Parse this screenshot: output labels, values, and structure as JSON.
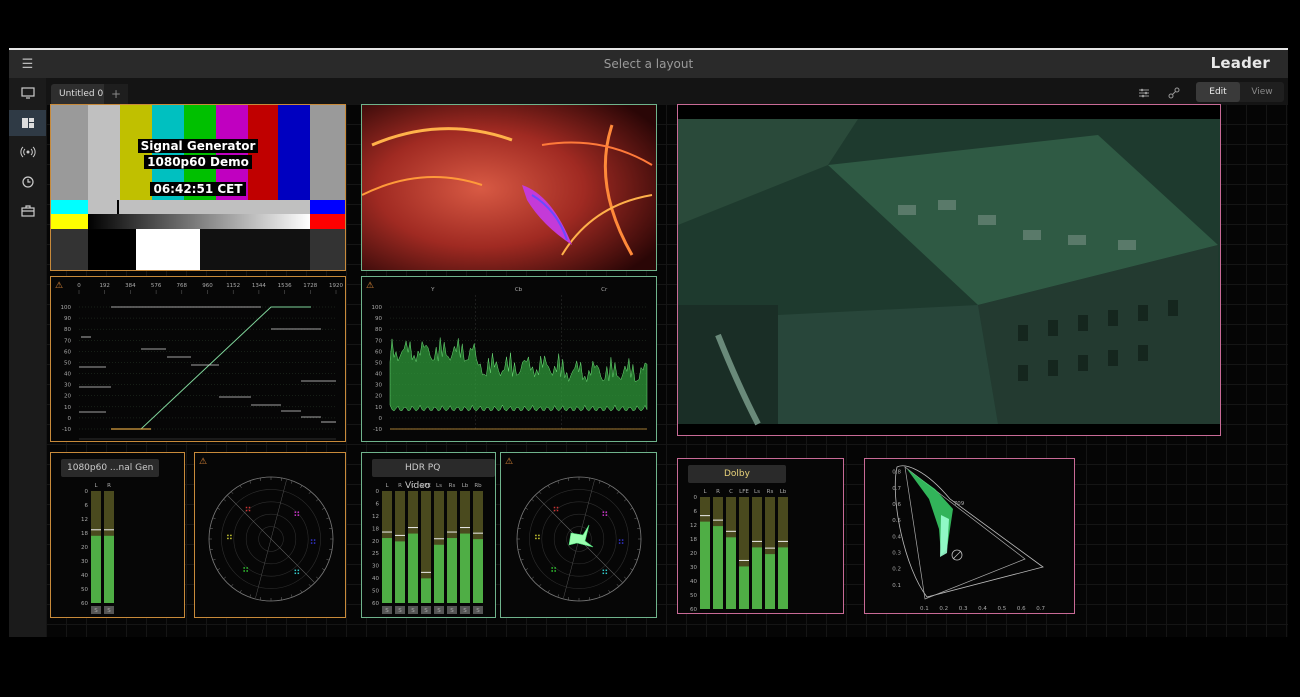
{
  "app": {
    "layout_title": "Select a layout",
    "brand": "Leader",
    "menu_icon": "hamburger-icon"
  },
  "sidebar": {
    "items": [
      {
        "name": "monitor",
        "icon": "monitor-icon"
      },
      {
        "name": "layouts",
        "icon": "layout-icon",
        "active": true
      },
      {
        "name": "signal",
        "icon": "broadcast-icon"
      },
      {
        "name": "clock",
        "icon": "clock-icon"
      },
      {
        "name": "toolbox",
        "icon": "toolbox-icon"
      }
    ]
  },
  "tabs": {
    "items": [
      {
        "label": "Untitled 0"
      }
    ],
    "add_label": "+"
  },
  "toolbar": {
    "settings_icon": "sliders-icon",
    "link_icon": "link-icon",
    "edit_label": "Edit",
    "view_label": "View"
  },
  "signal_generator": {
    "line1": "Signal Generator",
    "line2": "1080p60 Demo",
    "time": "06:42:51 CET"
  },
  "waveform1": {
    "x_ticks": [
      "0",
      "192",
      "384",
      "576",
      "768",
      "960",
      "1152",
      "1344",
      "1536",
      "1728",
      "1920"
    ],
    "y_ticks": [
      "100",
      "90",
      "80",
      "70",
      "60",
      "50",
      "40",
      "30",
      "20",
      "10",
      "0",
      "-10"
    ]
  },
  "waveform2": {
    "channels": [
      "Y",
      "Cb",
      "Cr"
    ],
    "y_ticks": [
      "100",
      "90",
      "80",
      "70",
      "60",
      "50",
      "40",
      "30",
      "20",
      "10",
      "0",
      "-10"
    ]
  },
  "audio1": {
    "label": "1080p60 ...nal Gen",
    "channels": [
      "L",
      "R"
    ],
    "levels": [
      0.6,
      0.6
    ],
    "scale": [
      "0",
      "6",
      "12",
      "18",
      "20",
      "30",
      "40",
      "50",
      "60"
    ],
    "footer": [
      "S",
      "S"
    ]
  },
  "audio2": {
    "label": "HDR PQ Video",
    "channels": [
      "L",
      "R",
      "C",
      "LFE",
      "Ls",
      "Rs",
      "Lb",
      "Rb"
    ],
    "levels": [
      0.58,
      0.55,
      0.62,
      0.22,
      0.52,
      0.58,
      0.62,
      0.57
    ],
    "scale": [
      "0",
      "6",
      "12",
      "18",
      "20",
      "25",
      "30",
      "40",
      "50",
      "60"
    ],
    "footer": [
      "S",
      "S",
      "S",
      "S",
      "S",
      "S",
      "S",
      "S"
    ]
  },
  "audio3": {
    "label": "Dolby",
    "channels": [
      "L",
      "R",
      "C",
      "LFE",
      "Ls",
      "Rs",
      "Lb"
    ],
    "levels": [
      0.78,
      0.74,
      0.64,
      0.38,
      0.55,
      0.49,
      0.55
    ],
    "scale": [
      "0",
      "6",
      "12",
      "18",
      "20",
      "30",
      "40",
      "50",
      "60"
    ]
  },
  "cie": {
    "axis_x": [
      "0.1",
      "0.2",
      "0.3",
      "0.4",
      "0.5",
      "0.6",
      "0.7"
    ],
    "axis_y": [
      "0.8",
      "0.7",
      "0.6",
      "0.5",
      "0.4",
      "0.3",
      "0.2",
      "0.1"
    ],
    "marker": "709"
  },
  "colors": {
    "orange_border": "#c88a3a",
    "green_border": "#6fb38c",
    "pink_border": "#c86a96",
    "meter_green": "#4fae45",
    "meter_olive": "#4a4a1e"
  }
}
